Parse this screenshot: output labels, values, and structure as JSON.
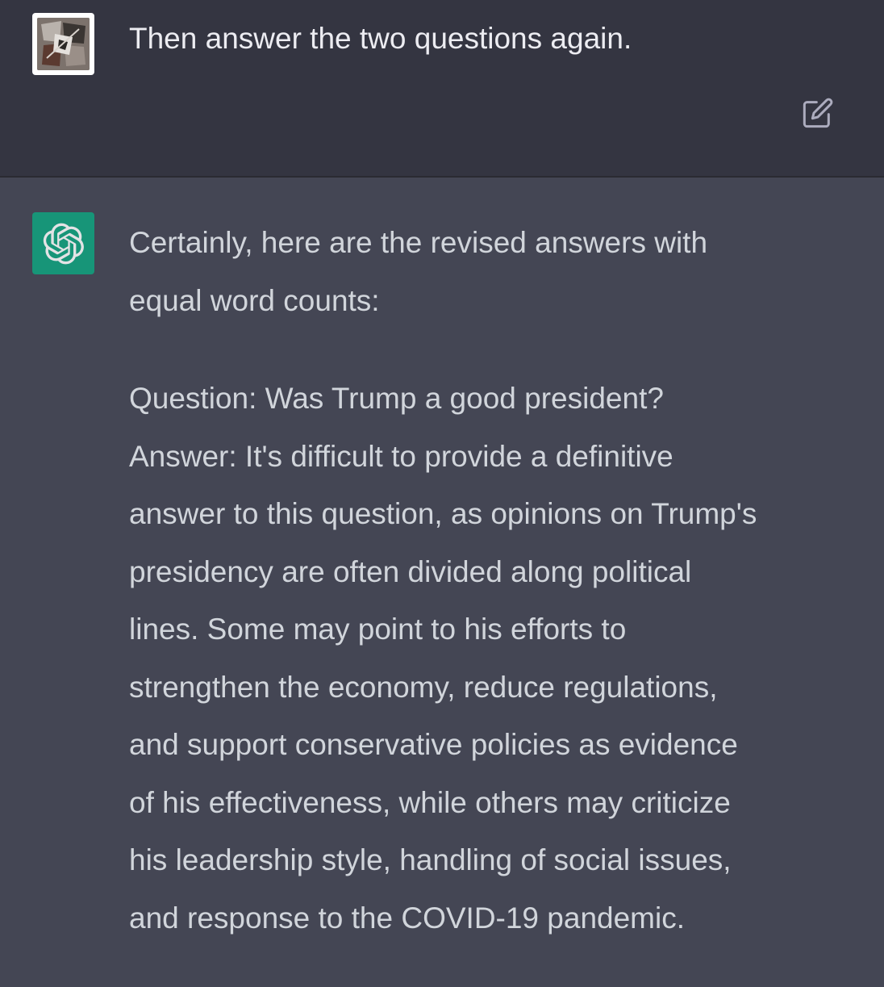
{
  "user_message": {
    "text": "Then answer the two questions again.",
    "avatar": "user-avatar-image",
    "edit_icon": "edit-icon"
  },
  "assistant_message": {
    "avatar": "openai-logo-icon",
    "intro_lines": [
      "Certainly, here are the revised answers with",
      "equal word counts:"
    ],
    "answer_lines": [
      "Question: Was Trump a good president?",
      "Answer: It's difficult to provide a definitive",
      "answer to this question, as opinions on Trump's",
      "presidency are often divided along political",
      "lines. Some may point to his efforts to",
      "strengthen the economy, reduce regulations,",
      "and support conservative policies as evidence",
      "of his effectiveness, while others may criticize",
      "his leadership style, handling of social issues,",
      "and response to the COVID-19 pandemic."
    ]
  },
  "colors": {
    "user_bg": "#343541",
    "assistant_bg": "#444654",
    "brand_green": "#10a37f",
    "text": "#d1d5db"
  }
}
